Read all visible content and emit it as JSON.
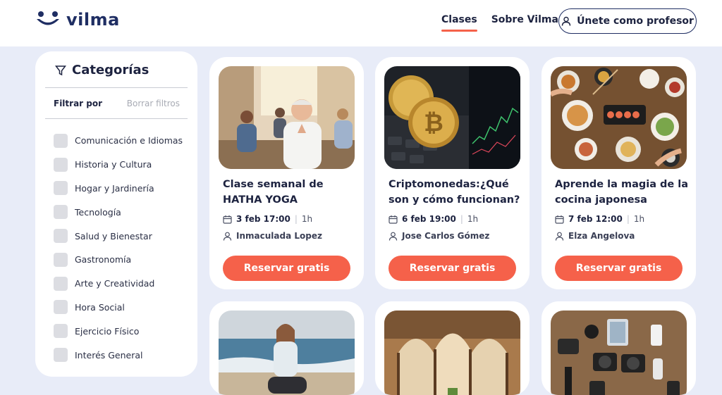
{
  "header": {
    "logo_text": "vilma",
    "nav": [
      {
        "label": "Clases",
        "active": true
      },
      {
        "label": "Sobre Vilma",
        "active": false
      }
    ],
    "join_button": "Únete como profesor"
  },
  "sidebar": {
    "title": "Categorías",
    "filter_label": "Filtrar por",
    "clear_label": "Borrar filtros",
    "categories": [
      "Comunicación e Idiomas",
      "Historia y Cultura",
      "Hogar y Jardinería",
      "Tecnología",
      "Salud y Bienestar",
      "Gastronomía",
      "Arte y Creatividad",
      "Hora Social",
      "Ejercicio Físico",
      "Interés General"
    ]
  },
  "cards": [
    {
      "title": "Clase semanal de HATHA YOGA",
      "date": "3 feb 17:00",
      "duration": "1h",
      "teacher": "Inmaculada Lopez",
      "button": "Reservar gratis",
      "image": "yoga-class-photo"
    },
    {
      "title": "Criptomonedas:¿Qué son y cómo funcionan?",
      "date": "6 feb 19:00",
      "duration": "1h",
      "teacher": "Jose Carlos Gómez",
      "button": "Reservar gratis",
      "image": "bitcoin-photo"
    },
    {
      "title": "Aprende la magia de la cocina japonesa",
      "date": "7 feb 12:00",
      "duration": "1h",
      "teacher": "Elza Angelova",
      "button": "Reservar gratis",
      "image": "japanese-food-photo"
    },
    {
      "image": "beach-meditation-photo"
    },
    {
      "image": "alhambra-arches-photo"
    },
    {
      "image": "camera-gear-photo"
    }
  ],
  "colors": {
    "accent": "#f5614a",
    "brand": "#1f2e63",
    "background": "#e8ecf8"
  }
}
